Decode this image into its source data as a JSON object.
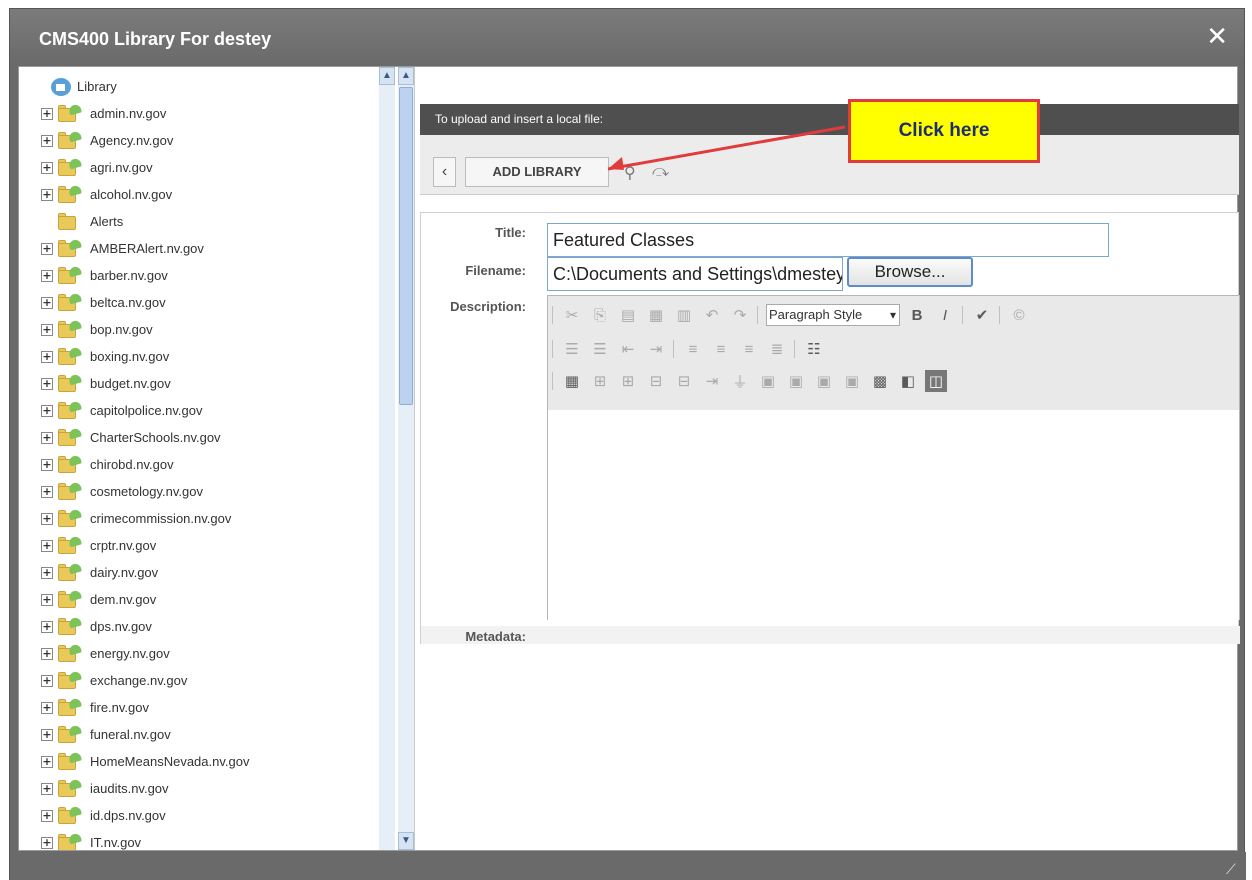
{
  "window": {
    "title": "CMS400 Library For destey",
    "close_glyph": "✕"
  },
  "tree": {
    "root_label": "Library",
    "items": [
      {
        "label": "admin.nv.gov",
        "expandable": true
      },
      {
        "label": "Agency.nv.gov",
        "expandable": true
      },
      {
        "label": "agri.nv.gov",
        "expandable": true
      },
      {
        "label": "alcohol.nv.gov",
        "expandable": true
      },
      {
        "label": "Alerts",
        "expandable": false
      },
      {
        "label": "AMBERAlert.nv.gov",
        "expandable": true
      },
      {
        "label": "barber.nv.gov",
        "expandable": true
      },
      {
        "label": "beltca.nv.gov",
        "expandable": true
      },
      {
        "label": "bop.nv.gov",
        "expandable": true
      },
      {
        "label": "boxing.nv.gov",
        "expandable": true
      },
      {
        "label": "budget.nv.gov",
        "expandable": true
      },
      {
        "label": "capitolpolice.nv.gov",
        "expandable": true
      },
      {
        "label": "CharterSchools.nv.gov",
        "expandable": true
      },
      {
        "label": "chirobd.nv.gov",
        "expandable": true
      },
      {
        "label": "cosmetology.nv.gov",
        "expandable": true
      },
      {
        "label": "crimecommission.nv.gov",
        "expandable": true
      },
      {
        "label": "crptr.nv.gov",
        "expandable": true
      },
      {
        "label": "dairy.nv.gov",
        "expandable": true
      },
      {
        "label": "dem.nv.gov",
        "expandable": true
      },
      {
        "label": "dps.nv.gov",
        "expandable": true
      },
      {
        "label": "energy.nv.gov",
        "expandable": true
      },
      {
        "label": "exchange.nv.gov",
        "expandable": true
      },
      {
        "label": "fire.nv.gov",
        "expandable": true
      },
      {
        "label": "funeral.nv.gov",
        "expandable": true
      },
      {
        "label": "HomeMeansNevada.nv.gov",
        "expandable": true
      },
      {
        "label": "iaudits.nv.gov",
        "expandable": true
      },
      {
        "label": "id.dps.nv.gov",
        "expandable": true
      },
      {
        "label": "IT.nv.gov",
        "expandable": true
      }
    ]
  },
  "upload": {
    "banner": "To upload and insert a local file:",
    "add_library_label": "ADD LIBRARY",
    "callout_text": "Click here"
  },
  "form": {
    "title_label": "Title:",
    "title_value": "Featured Classes",
    "filename_label": "Filename:",
    "filename_value": "C:\\Documents and Settings\\dmestey\\My Doc",
    "browse_label": "Browse...",
    "description_label": "Description:",
    "metadata_label": "Metadata:",
    "paragraph_style": "Paragraph Style"
  },
  "colors": {
    "titlebar": "#6a6a6a",
    "banner": "#4f4f4f",
    "callout_fill": "#ffff00",
    "callout_border": "#e23b3b"
  }
}
